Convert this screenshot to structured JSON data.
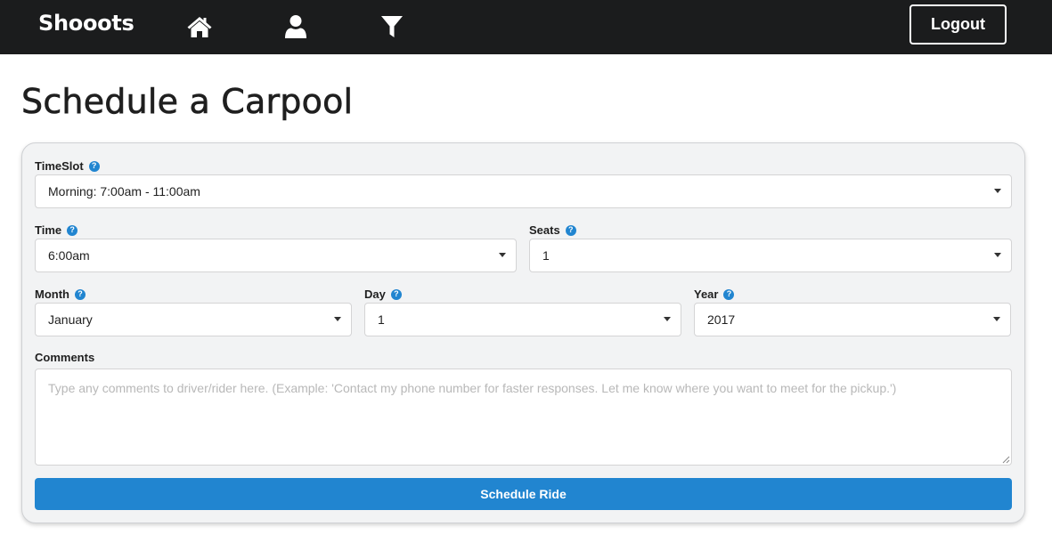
{
  "navbar": {
    "brand": "Shooots",
    "icons": [
      "home-icon",
      "user-icon",
      "filter-icon"
    ],
    "logout_label": "Logout"
  },
  "page": {
    "title": "Schedule a Carpool"
  },
  "form": {
    "timeslot": {
      "label": "TimeSlot",
      "value": "Morning: 7:00am - 11:00am"
    },
    "time": {
      "label": "Time",
      "value": "6:00am"
    },
    "seats": {
      "label": "Seats",
      "value": "1"
    },
    "month": {
      "label": "Month",
      "value": "January"
    },
    "day": {
      "label": "Day",
      "value": "1"
    },
    "year": {
      "label": "Year",
      "value": "2017"
    },
    "comments": {
      "label": "Comments",
      "placeholder": "Type any comments to driver/rider here. (Example: 'Contact my phone number for faster responses. Let me know where you want to meet for the pickup.')",
      "value": ""
    },
    "submit_label": "Schedule Ride"
  },
  "colors": {
    "navbar_bg": "#1b1c1d",
    "accent": "#2185d0",
    "panel_bg": "#f2f3f4"
  }
}
